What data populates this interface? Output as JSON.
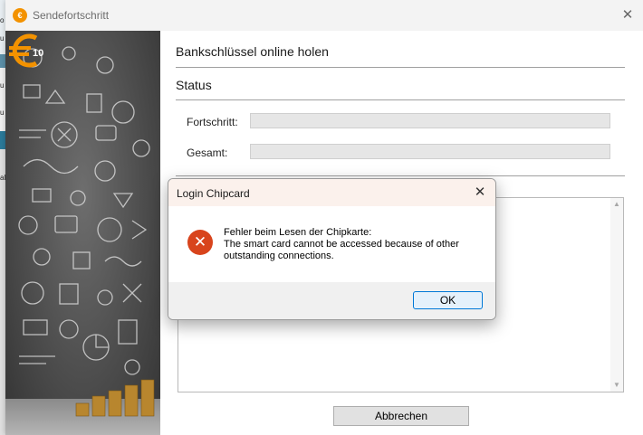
{
  "background_strip": {
    "chips": [
      "o",
      "u",
      "u",
      "u",
      "u",
      "u",
      "u",
      "al"
    ]
  },
  "window": {
    "title": "Sendefortschritt",
    "icon_text": "€",
    "close_glyph": "✕"
  },
  "branding": {
    "logo_text": "10"
  },
  "content": {
    "section_title": "Bankschlüssel online holen",
    "status_title": "Status",
    "progress_label": "Fortschritt:",
    "total_label": "Gesamt:",
    "progress_value": 0,
    "total_value": 0,
    "cancel_label": "Abbrechen"
  },
  "dialog": {
    "title": "Login Chipcard",
    "close_glyph": "✕",
    "icon_glyph": "✕",
    "message_line1": "Fehler beim Lesen der Chipkarte:",
    "message_line2": "The smart card cannot be accessed because of other",
    "message_line3": "outstanding connections.",
    "ok_label": "OK"
  },
  "colors": {
    "accent": "#0078d7",
    "error": "#d8441c",
    "brand": "#f39200"
  }
}
